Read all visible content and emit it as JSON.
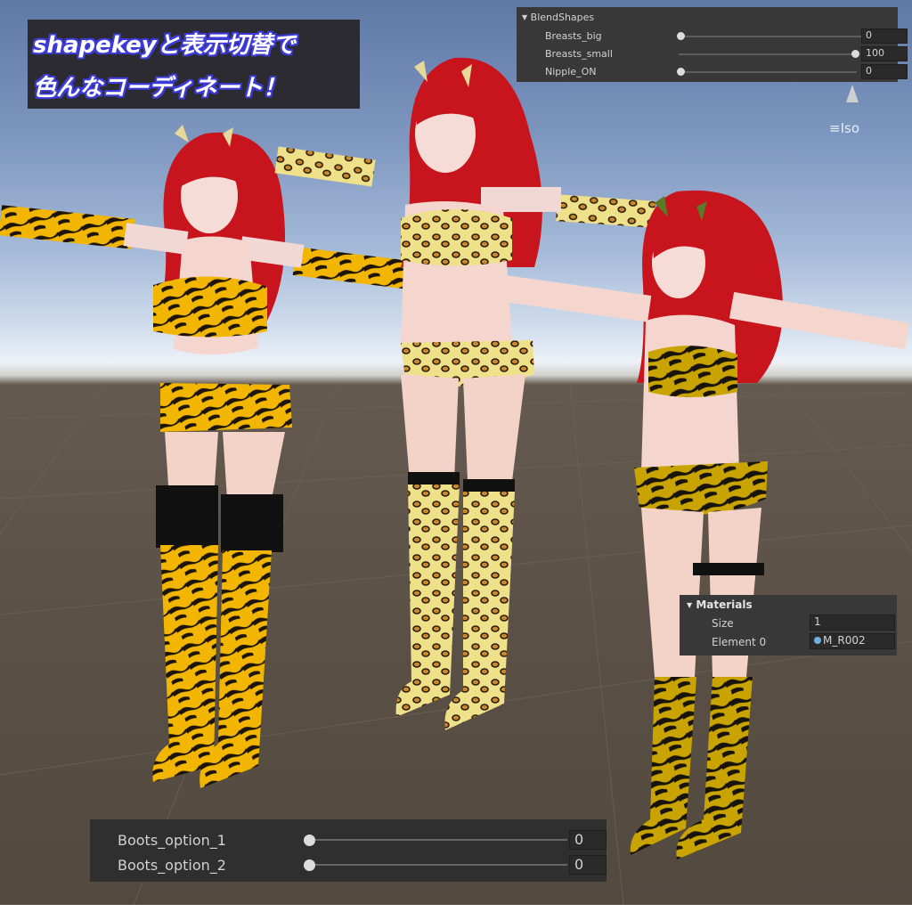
{
  "caption": {
    "line1": "shapekeyと表示切替で",
    "line2": "色んなコーディネート！"
  },
  "blendshapes_panel": {
    "title": "BlendShapes",
    "rows": [
      {
        "label": "Breasts_big",
        "value": "0",
        "slider": 0
      },
      {
        "label": "Breasts_small",
        "value": "100",
        "slider": 1
      },
      {
        "label": "Nipple_ON",
        "value": "0",
        "slider": 0
      }
    ]
  },
  "scene_gizmo": {
    "projection_label": "Iso"
  },
  "materials_panel": {
    "title": "Materials",
    "size_label": "Size",
    "size_value": "1",
    "element_label": "Element 0",
    "element_value": "M_R002"
  },
  "boots_panel": {
    "rows": [
      {
        "label": "Boots_option_1",
        "value": "0",
        "slider": 0
      },
      {
        "label": "Boots_option_2",
        "value": "0",
        "slider": 0
      }
    ]
  },
  "colors": {
    "panel_bg": "#383838",
    "caption_bg": "#2b2b31",
    "caption_outline": "#3d3bd6",
    "hair": "#c8141c",
    "tiger_yellow": "#f2b600",
    "leopard_yellow": "#efe08a"
  }
}
